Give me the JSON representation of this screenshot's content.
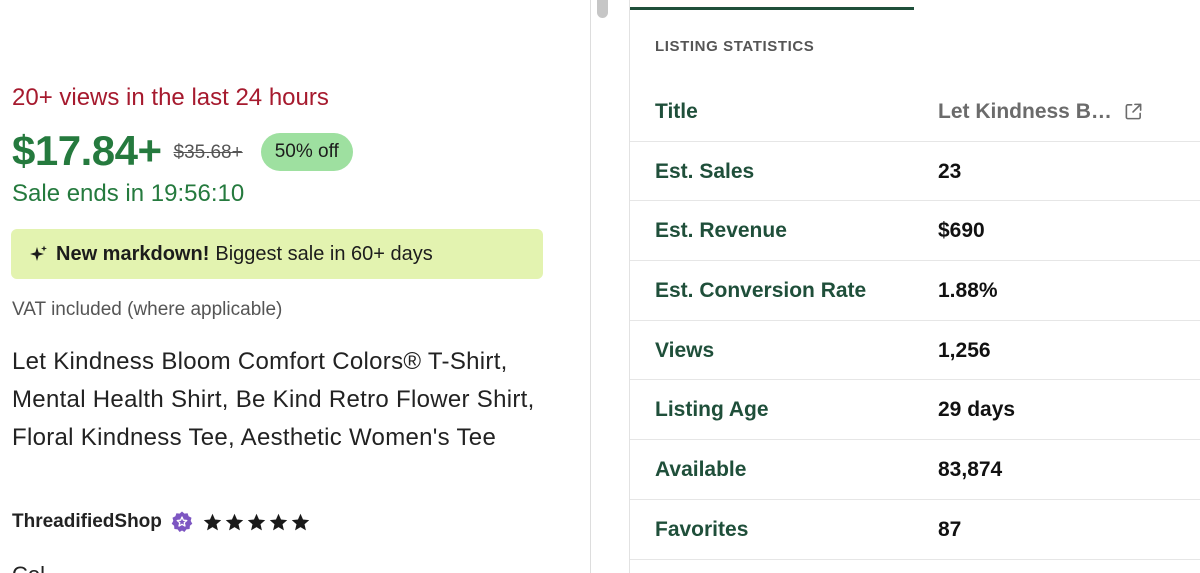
{
  "listing": {
    "views_note": "20+ views in the last 24 hours",
    "price": "$17.84+",
    "original_price": "$35.68+",
    "discount_badge": "50% off",
    "sale_ends": "Sale ends in 19:56:10",
    "markdown_banner": {
      "icon": "sparkle-icon",
      "strong": "New markdown!",
      "text": "Biggest sale in 60+ days"
    },
    "vat_note": "VAT included (where applicable)",
    "title": "Let Kindness Bloom Comfort Colors® T-Shirt, Mental Health Shirt, Be Kind Retro Flower Shirt, Floral Kindness Tee, Aesthetic Women's Tee",
    "shop_name": "ThreadifiedShop",
    "star_seller_icon": "star-seller-badge-icon",
    "rating_stars": 5,
    "cutoff_label": "Col"
  },
  "stats_panel": {
    "heading": "LISTING STATISTICS",
    "rows": [
      {
        "label": "Title",
        "value": "Let Kindness Bloom Comfort Colors® T-Shirt"
      },
      {
        "label": "Est. Sales",
        "value": "23"
      },
      {
        "label": "Est. Revenue",
        "value": "$690"
      },
      {
        "label": "Est. Conversion Rate",
        "value": "1.88%"
      },
      {
        "label": "Views",
        "value": "1,256"
      },
      {
        "label": "Listing Age",
        "value": "29 days"
      },
      {
        "label": "Available",
        "value": "83,874"
      },
      {
        "label": "Favorites",
        "value": "87"
      }
    ]
  },
  "colors": {
    "views_note": "#a61a2e",
    "price_green": "#257a3e",
    "discount_badge_bg": "#9ee0a0",
    "markdown_banner_bg": "#e3f3b0",
    "stat_label": "#1f4f3a",
    "star_seller": "#7d56c2"
  }
}
